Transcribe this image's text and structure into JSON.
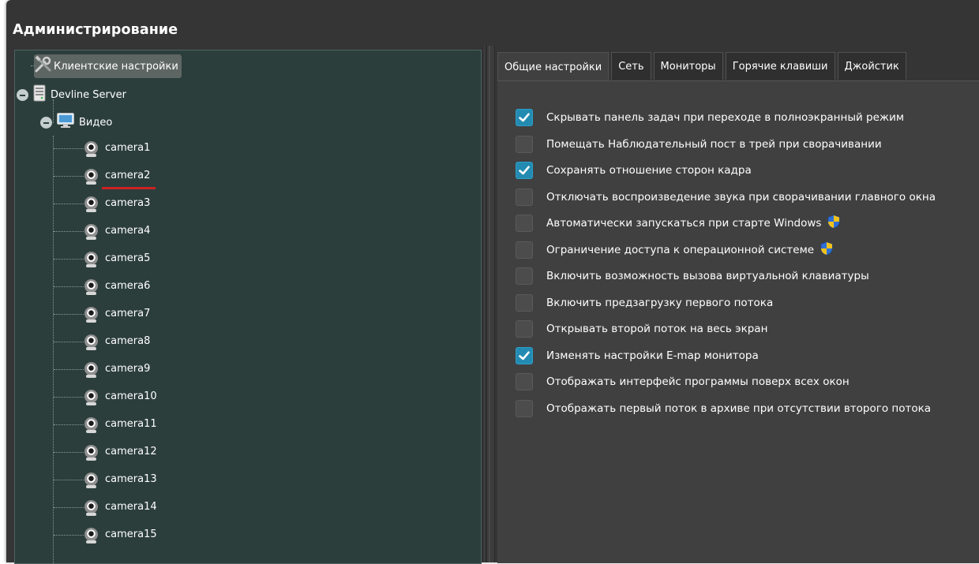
{
  "window": {
    "title": "Администрирование"
  },
  "tree": {
    "client_settings": "Клиентские настройки",
    "server": "Devline Server",
    "video": "Видео",
    "cameras": [
      "camera1",
      "camera2",
      "camera3",
      "camera4",
      "camera5",
      "camera6",
      "camera7",
      "camera8",
      "camera9",
      "camera10",
      "camera11",
      "camera12",
      "camera13",
      "camera14",
      "camera15"
    ],
    "selected_camera": "camera2"
  },
  "tabs": [
    {
      "label": "Общие настройки",
      "active": true
    },
    {
      "label": "Сеть",
      "active": false
    },
    {
      "label": "Мониторы",
      "active": false
    },
    {
      "label": "Горячие клавиши",
      "active": false
    },
    {
      "label": "Джойстик",
      "active": false
    }
  ],
  "options": [
    {
      "label": "Скрывать панель задач при переходе в полноэкранный режим",
      "checked": true,
      "shield": false
    },
    {
      "label": "Помещать Наблюдательный пост в трей при сворачивании",
      "checked": false,
      "shield": false
    },
    {
      "label": "Сохранять отношение сторон кадра",
      "checked": true,
      "shield": false
    },
    {
      "label": "Отключать воспроизведение звука при сворачивании главного окна",
      "checked": false,
      "shield": false
    },
    {
      "label": "Автоматически запускаться при старте Windows",
      "checked": false,
      "shield": true
    },
    {
      "label": "Ограничение доступа к операционной системе",
      "checked": false,
      "shield": true
    },
    {
      "label": "Включить возможность вызова виртуальной клавиатуры",
      "checked": false,
      "shield": false
    },
    {
      "label": "Включить предзагрузку первого потока",
      "checked": false,
      "shield": false
    },
    {
      "label": "Открывать второй поток на весь экран",
      "checked": false,
      "shield": false
    },
    {
      "label": "Изменять настройки E-map монитора",
      "checked": true,
      "shield": false
    },
    {
      "label": "Отображать интерфейс программы поверх всех окон",
      "checked": false,
      "shield": false
    },
    {
      "label": "Отображать первый поток в архиве при отсутствии второго потока",
      "checked": false,
      "shield": false
    }
  ],
  "colors": {
    "checkbox_checked": "#238bb1",
    "tree_bg": "#2b3e3c",
    "window_bg": "#353535",
    "selection_underline": "#cc2222"
  },
  "icons": {
    "client_settings": "tools-icon",
    "server": "server-icon",
    "video": "monitor-icon",
    "camera": "webcam-icon",
    "shield": "uac-shield-icon"
  }
}
